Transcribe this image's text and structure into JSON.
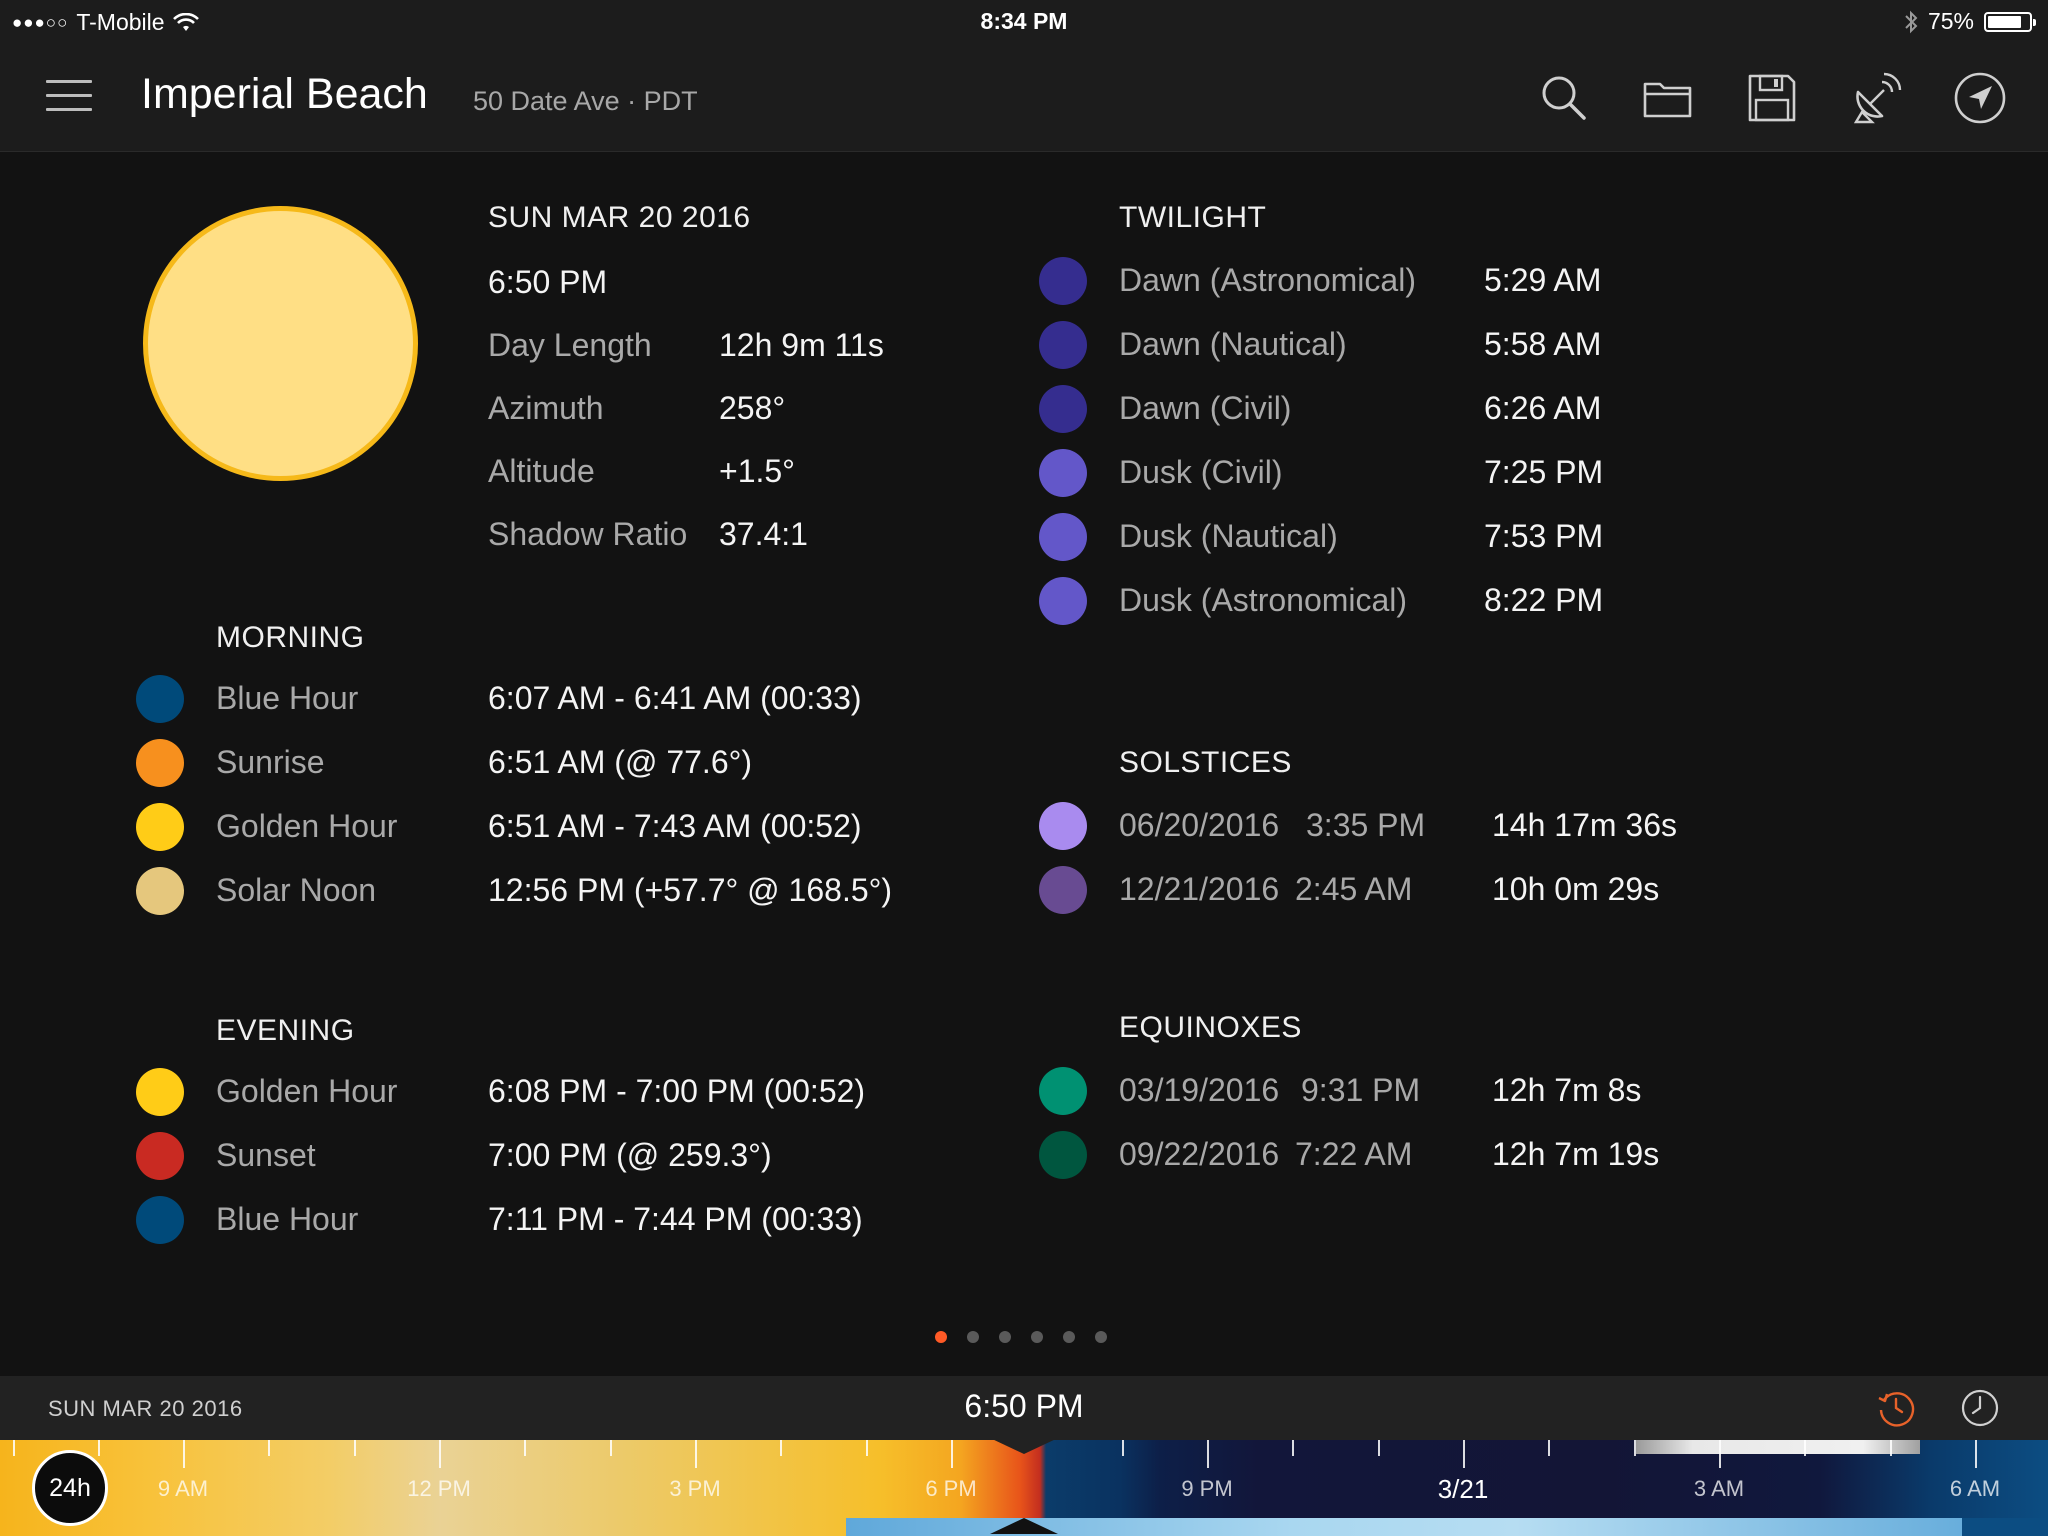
{
  "status_bar": {
    "carrier": "T-Mobile",
    "signal": "●●●○○",
    "time": "8:34 PM",
    "battery": "75%"
  },
  "nav": {
    "title": "Imperial Beach",
    "subtitle": "50 Date Ave · PDT"
  },
  "sun_info": {
    "date": "SUN MAR 20 2016",
    "time": "6:50 PM",
    "rows": [
      {
        "label": "Day Length",
        "value": "12h 9m 11s"
      },
      {
        "label": "Azimuth",
        "value": "258°"
      },
      {
        "label": "Altitude",
        "value": "+1.5°"
      },
      {
        "label": "Shadow Ratio",
        "value": "37.4:1"
      }
    ]
  },
  "morning": {
    "heading": "MORNING",
    "rows": [
      {
        "label": "Blue Hour",
        "value": "6:07 AM - 6:41 AM (00:33)",
        "color": "#004a7a"
      },
      {
        "label": "Sunrise",
        "value": "6:51 AM (@ 77.6°)",
        "color": "#f7901e"
      },
      {
        "label": "Golden Hour",
        "value": "6:51 AM - 7:43 AM (00:52)",
        "color": "#ffcc17"
      },
      {
        "label": "Solar Noon",
        "value": "12:56 PM (+57.7° @ 168.5°)",
        "color": "#e5c77d"
      }
    ]
  },
  "evening": {
    "heading": "EVENING",
    "rows": [
      {
        "label": "Golden Hour",
        "value": "6:08 PM - 7:00 PM (00:52)",
        "color": "#ffcc17"
      },
      {
        "label": "Sunset",
        "value": "7:00 PM (@ 259.3°)",
        "color": "#c92a22"
      },
      {
        "label": "Blue Hour",
        "value": "7:11 PM - 7:44 PM (00:33)",
        "color": "#004a7a"
      }
    ]
  },
  "twilight": {
    "heading": "TWILIGHT",
    "rows": [
      {
        "label": "Dawn (Astronomical)",
        "value": "5:29 AM",
        "color": "#352d8f"
      },
      {
        "label": "Dawn (Nautical)",
        "value": "5:58 AM",
        "color": "#352d8f"
      },
      {
        "label": "Dawn (Civil)",
        "value": "6:26 AM",
        "color": "#352d8f"
      },
      {
        "label": "Dusk (Civil)",
        "value": "7:25 PM",
        "color": "#6357c9"
      },
      {
        "label": "Dusk (Nautical)",
        "value": "7:53 PM",
        "color": "#6357c9"
      },
      {
        "label": "Dusk (Astronomical)",
        "value": "8:22 PM",
        "color": "#6357c9"
      }
    ]
  },
  "solstices": {
    "heading": "SOLSTICES",
    "rows": [
      {
        "date": "06/20/2016",
        "time": "3:35 PM",
        "value": "14h 17m 36s",
        "color": "#a98bef"
      },
      {
        "date": "12/21/2016",
        "time": "2:45 AM",
        "value": "10h 0m 29s",
        "color": "#684b92"
      }
    ]
  },
  "equinoxes": {
    "heading": "EQUINOXES",
    "rows": [
      {
        "date": "03/19/2016",
        "time": "9:31 PM",
        "value": "12h 7m 8s",
        "color": "#009172"
      },
      {
        "date": "09/22/2016",
        "time": "7:22 AM",
        "value": "12h 7m 19s",
        "color": "#00563f"
      }
    ]
  },
  "pager": {
    "count": 6,
    "active": 0
  },
  "bottom_bar": {
    "date": "SUN MAR 20 2016",
    "time": "6:50 PM"
  },
  "timeline": {
    "toggle_label": "24h",
    "labels": [
      "9 AM",
      "12 PM",
      "3 PM",
      "6 PM",
      "9 PM",
      "3/21",
      "3 AM",
      "6 AM"
    ]
  },
  "icons": {
    "menu": "hamburger-icon",
    "search": "search-icon",
    "open": "folder-icon",
    "save": "save-icon",
    "satellite": "satellite-dish-icon",
    "location": "location-arrow-icon",
    "reset_time": "clock-reset-icon",
    "clock": "clock-icon"
  },
  "colors": {
    "accent": "#ff5a26",
    "sun_fill": "#ffdf85",
    "sun_stroke": "#f6b919"
  }
}
